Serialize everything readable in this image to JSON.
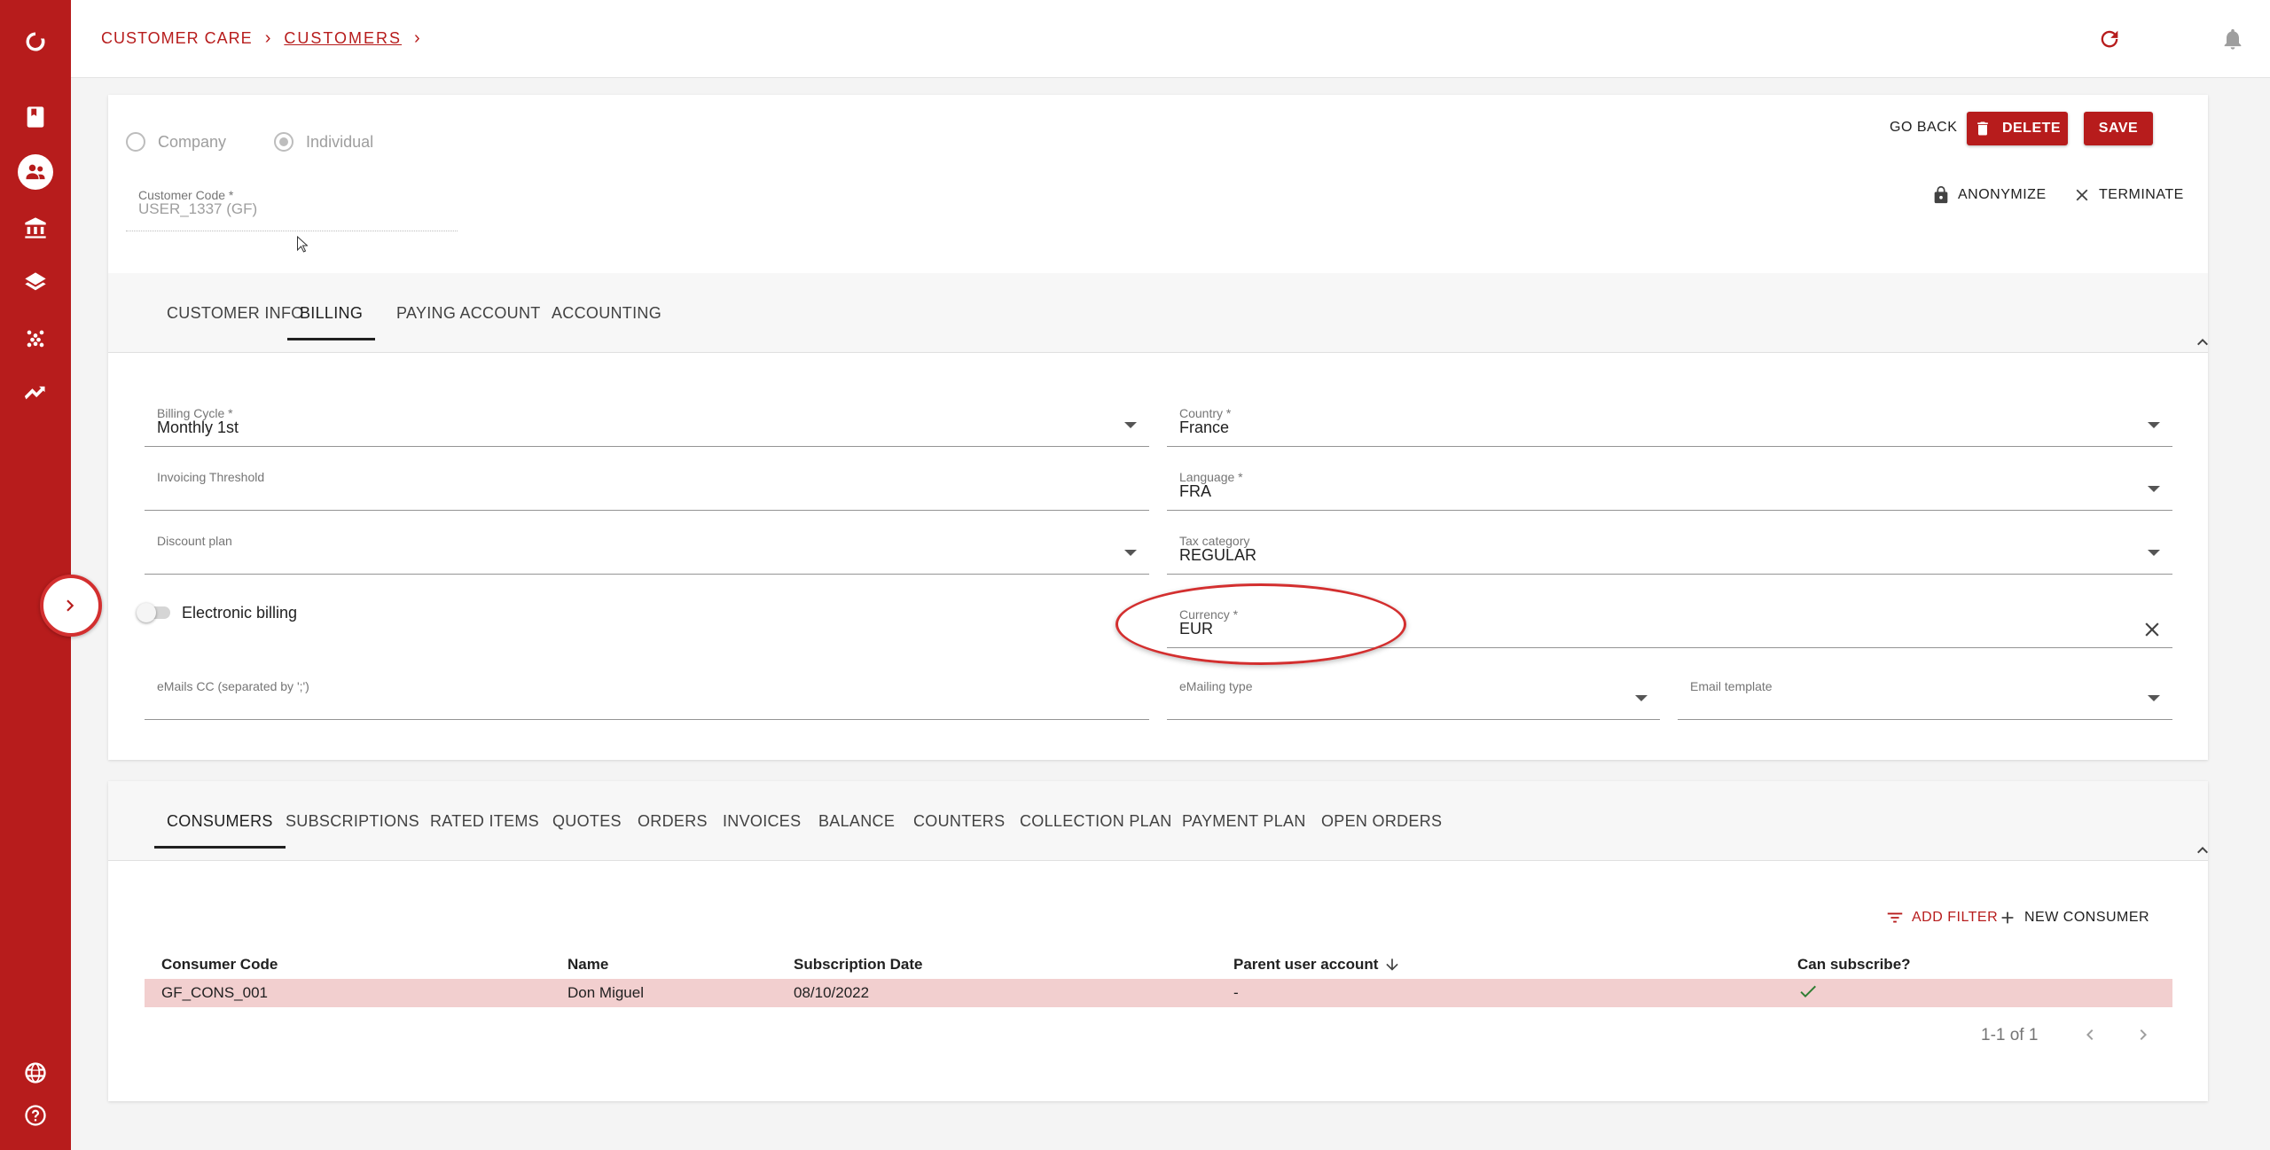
{
  "breadcrumb": {
    "item1": "CUSTOMER CARE",
    "item2": "CUSTOMERS",
    "separator": "›"
  },
  "customer_type": {
    "option1": "Company",
    "option2": "Individual",
    "selected": "Individual"
  },
  "customer_code": {
    "label": "Customer Code *",
    "value": "USER_1337 (GF)"
  },
  "actions": {
    "go_back": "GO BACK",
    "delete": "DELETE",
    "save": "SAVE",
    "anonymize": "ANONYMIZE",
    "terminate": "TERMINATE"
  },
  "tabs": [
    "CUSTOMER INFO",
    "BILLING",
    "PAYING ACCOUNT",
    "ACCOUNTING"
  ],
  "active_tab": "BILLING",
  "billing": {
    "billing_cycle": {
      "label": "Billing Cycle *",
      "value": "Monthly 1st"
    },
    "country": {
      "label": "Country *",
      "value": "France"
    },
    "invoicing_threshold": {
      "label": "Invoicing Threshold",
      "value": ""
    },
    "language": {
      "label": "Language *",
      "value": "FRA"
    },
    "discount_plan": {
      "label": "Discount plan",
      "value": ""
    },
    "tax_category": {
      "label": "Tax category",
      "value": "REGULAR"
    },
    "electronic_billing": {
      "label": "Electronic billing",
      "enabled": false
    },
    "currency": {
      "label": "Currency *",
      "value": "EUR"
    },
    "emails_cc": {
      "label": "eMails CC (separated by ';')",
      "value": ""
    },
    "emailing_type": {
      "label": "eMailing type",
      "value": ""
    },
    "email_template": {
      "label": "Email template",
      "value": ""
    }
  },
  "bottom_tabs": [
    "CONSUMERS",
    "SUBSCRIPTIONS",
    "RATED ITEMS",
    "QUOTES",
    "ORDERS",
    "INVOICES",
    "BALANCE",
    "COUNTERS",
    "COLLECTION PLAN",
    "PAYMENT PLAN",
    "OPEN ORDERS"
  ],
  "bottom_active_tab": "CONSUMERS",
  "consumers": {
    "add_filter": "ADD FILTER",
    "new_consumer": "NEW CONSUMER",
    "columns": [
      "Consumer Code",
      "Name",
      "Subscription Date",
      "Parent user account",
      "Can subscribe?"
    ],
    "rows": [
      {
        "consumer_code": "GF_CONS_001",
        "name": "Don Miguel",
        "subscription_date": "08/10/2022",
        "parent_user_account": "-",
        "can_subscribe": "check-icon"
      }
    ],
    "pagination": "1-1 of 1"
  },
  "colors": {
    "brand": "#b71c1c",
    "row_highlight": "#f2cfcf",
    "annotation": "#d32f2f"
  }
}
